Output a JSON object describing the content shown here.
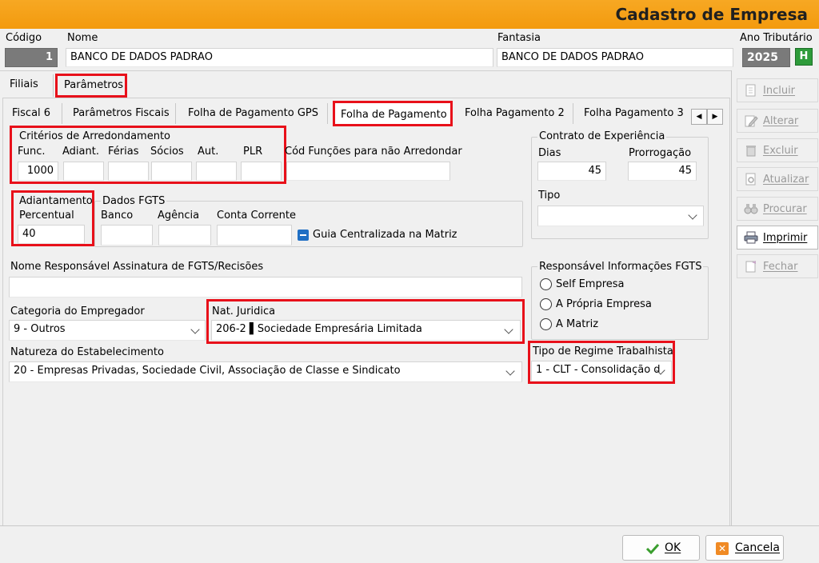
{
  "window": {
    "title": "Cadastro de Empresa"
  },
  "header": {
    "codigo_label": "Código",
    "codigo_value": "1",
    "nome_label": "Nome",
    "nome_value": "BANCO DE DADOS PADRAO",
    "fantasia_label": "Fantasia",
    "fantasia_value": "BANCO DE DADOS PADRAO",
    "ano_label": "Ano Tributário",
    "ano_value": "2025",
    "ano_button": "H"
  },
  "top_tabs": [
    "Filiais",
    "Parâmetros"
  ],
  "sub_tabs": [
    "Fiscal 6",
    "Parâmetros Fiscais",
    "Folha de Pagamento GPS",
    "Folha de Pagamento",
    "Folha Pagamento 2",
    "Folha Pagamento 3"
  ],
  "arredondamento": {
    "title": "Critérios de Arredondamento",
    "columns": [
      "Func.",
      "Adiant.",
      "Férias",
      "Sócios",
      "Aut.",
      "PLR"
    ],
    "values": [
      "1000",
      "",
      "",
      "",
      "",
      ""
    ],
    "cod_funcoes_label": "Cód Funções para não Arredondar",
    "cod_funcoes_value": ""
  },
  "contrato": {
    "title": "Contrato de Experiência",
    "dias_label": "Dias",
    "dias_value": "45",
    "prorrogacao_label": "Prorrogação",
    "prorrogacao_value": "45",
    "tipo_label": "Tipo",
    "tipo_value": ""
  },
  "adiantamento": {
    "title": "Adiantamento",
    "percentual_label": "Percentual",
    "percentual_value": "40"
  },
  "fgts": {
    "title": "Dados FGTS",
    "banco_label": "Banco",
    "banco_value": "",
    "agencia_label": "Agência",
    "agencia_value": "",
    "conta_label": "Conta Corrente",
    "conta_value": "",
    "guia_label": "Guia Centralizada na Matriz"
  },
  "responsavel_assinatura": {
    "label": "Nome Responsável Assinatura de FGTS/Recisões",
    "value": ""
  },
  "responsavel_fgts": {
    "title": "Responsável Informações FGTS",
    "options": [
      "Self Empresa",
      "A Própria Empresa",
      "A Matriz"
    ]
  },
  "categoria": {
    "label": "Categoria do Empregador",
    "value": "9 - Outros"
  },
  "nat_juridica": {
    "label": "Nat. Juridica",
    "value": "206-2 ▌Sociedade Empresária Limitada"
  },
  "natureza": {
    "label": "Natureza do Estabelecimento",
    "value": "20 - Empresas Privadas, Sociedade Civil, Associação de Classe e Sindicato"
  },
  "regime": {
    "label": "Tipo de Regime Trabalhista",
    "value": "1 - CLT - Consolidação d"
  },
  "sidebar": [
    "Incluir",
    "Alterar",
    "Excluir",
    "Atualizar",
    "Procurar",
    "Imprimir",
    "Fechar"
  ],
  "footer": {
    "ok": "OK",
    "cancel": "Cancela"
  }
}
